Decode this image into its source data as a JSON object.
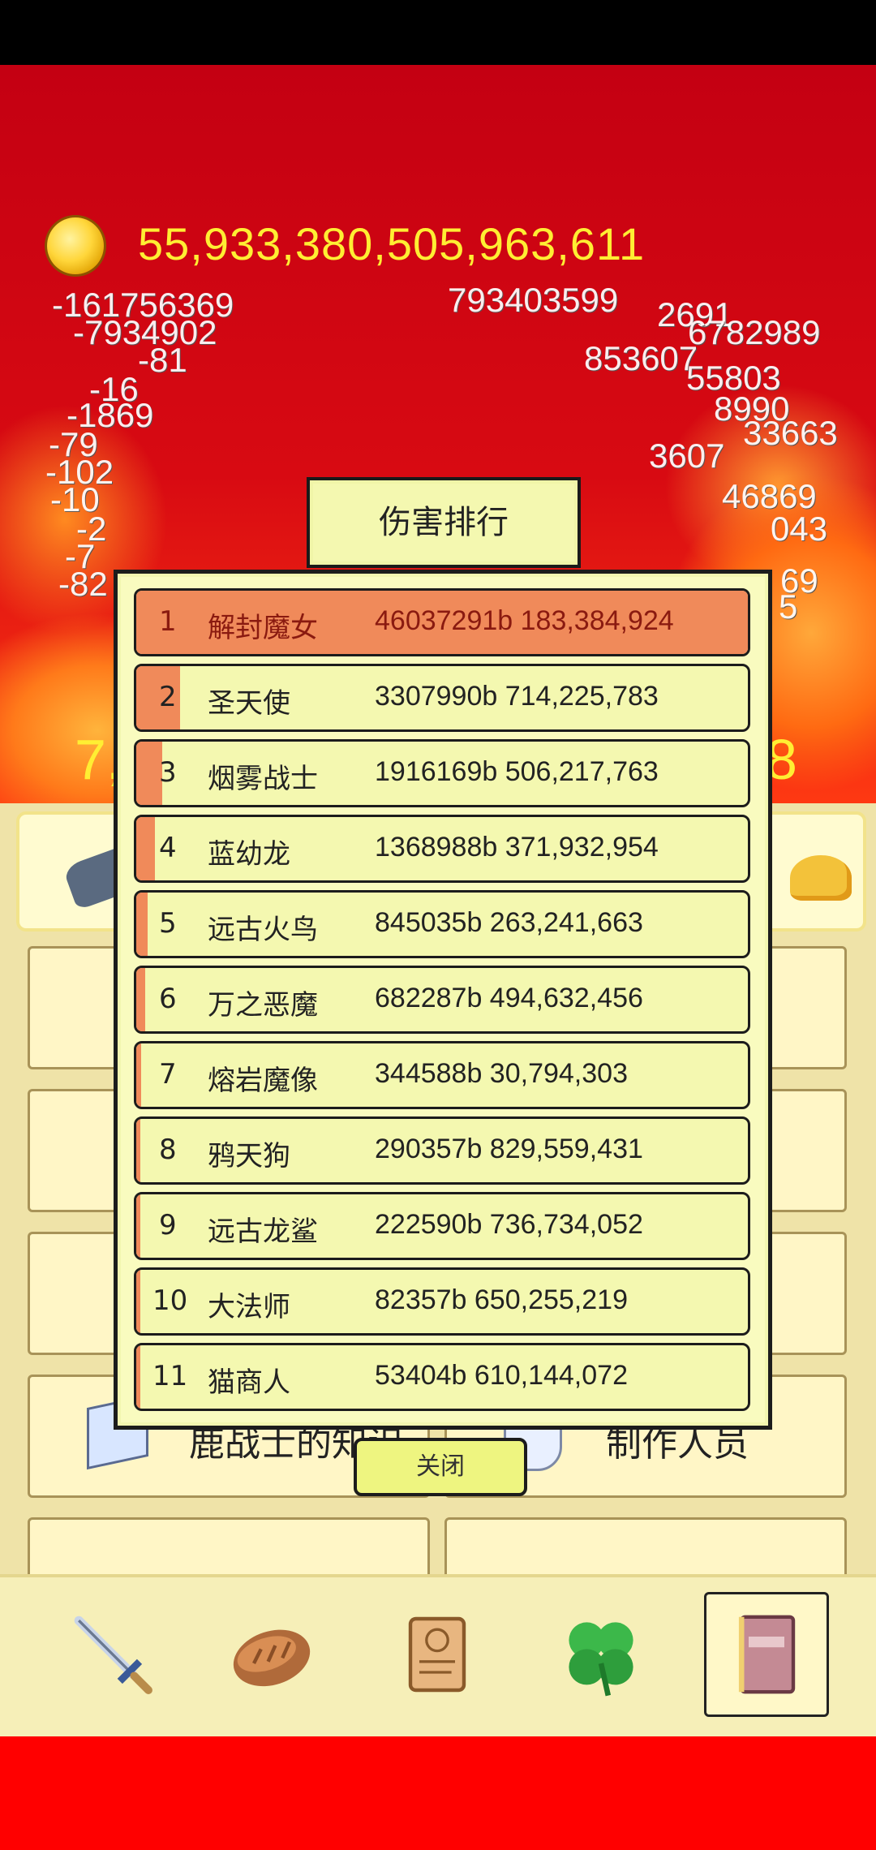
{
  "currency": {
    "value": "55,933,380,505,963,611",
    "icon": "gold-coin-icon"
  },
  "floating_numbers": [
    "-161756369",
    "-7934902",
    "-81",
    "-16",
    "-1869",
    "-79",
    "-102",
    "-10",
    "-2",
    "-7",
    "-82",
    "793403599",
    "2691",
    "6782989",
    "853607",
    "55803",
    "8990",
    "33663",
    "3607",
    "46869",
    "043",
    "69",
    "5"
  ],
  "dps": {
    "left": "7,",
    "right": "8"
  },
  "menu": {
    "cells": [
      {
        "label": "鹿战士的知识"
      },
      {
        "label": "制作人员"
      }
    ]
  },
  "toolbar": {
    "items": [
      {
        "icon": "sword-icon"
      },
      {
        "icon": "bread-icon"
      },
      {
        "icon": "scroll-icon"
      },
      {
        "icon": "clover-icon"
      },
      {
        "icon": "book-icon"
      }
    ]
  },
  "modal": {
    "title": "伤害排行",
    "close_label": "关闭",
    "rows": [
      {
        "rank": "1",
        "name": "解封魔女",
        "damage": "46037291b 183,384,924",
        "share": 1.0
      },
      {
        "rank": "2",
        "name": "圣天使",
        "damage": "3307990b 714,225,783",
        "share": 0.072
      },
      {
        "rank": "3",
        "name": "烟雾战士",
        "damage": "1916169b 506,217,763",
        "share": 0.042
      },
      {
        "rank": "4",
        "name": "蓝幼龙",
        "damage": "1368988b 371,932,954",
        "share": 0.03
      },
      {
        "rank": "5",
        "name": "远古火鸟",
        "damage": "845035b 263,241,663",
        "share": 0.018
      },
      {
        "rank": "6",
        "name": "万之恶魔",
        "damage": "682287b 494,632,456",
        "share": 0.015
      },
      {
        "rank": "7",
        "name": "熔岩魔像",
        "damage": "344588b 30,794,303",
        "share": 0.0075
      },
      {
        "rank": "8",
        "name": "鸦天狗",
        "damage": "290357b 829,559,431",
        "share": 0.0063
      },
      {
        "rank": "9",
        "name": "远古龙鲨",
        "damage": "222590b 736,734,052",
        "share": 0.0048
      },
      {
        "rank": "10",
        "name": "大法师",
        "damage": "82357b 650,255,219",
        "share": 0.0018
      },
      {
        "rank": "11",
        "name": "猫商人",
        "damage": "53404b 610,144,072",
        "share": 0.0012
      }
    ]
  }
}
